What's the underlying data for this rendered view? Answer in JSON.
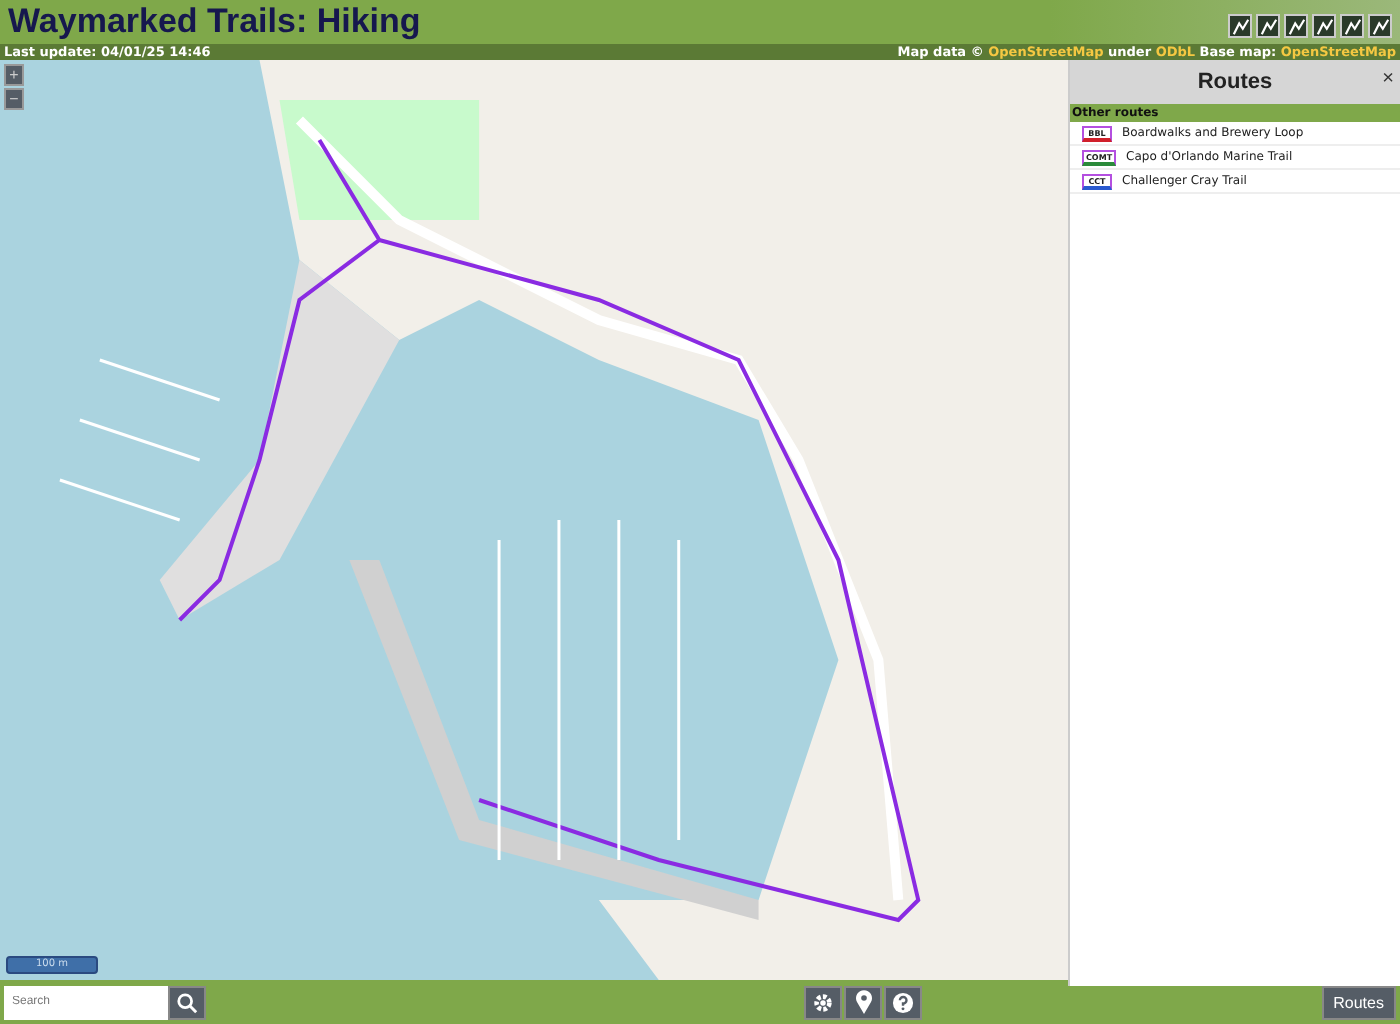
{
  "header": {
    "title": "Waymarked Trails: Hiking"
  },
  "info_bar": {
    "last_update": "Last update: 04/01/25 14:46",
    "credits": [
      {
        "kind": "text",
        "text": "Map data © "
      },
      {
        "kind": "link",
        "text": "OpenStreetMap"
      },
      {
        "kind": "text",
        "text": " under "
      },
      {
        "kind": "link",
        "text": "ODbL"
      },
      {
        "kind": "text",
        "text": " Base map: "
      },
      {
        "kind": "link",
        "text": "OpenStreetMap"
      }
    ]
  },
  "map": {
    "zoom_in": "+",
    "zoom_out": "−",
    "scale": "100 m"
  },
  "sidebar": {
    "title": "Routes",
    "close": "×",
    "section": "Other routes",
    "routes": [
      {
        "badge": "BBL",
        "color": "#d0202a",
        "name": "Boardwalks and Brewery Loop"
      },
      {
        "badge": "COMT",
        "color": "#2a8a3a",
        "name": "Capo d'Orlando Marine Trail"
      },
      {
        "badge": "CCT",
        "color": "#2a5ad0",
        "name": "Challenger Cray Trail"
      }
    ]
  },
  "bottom_bar": {
    "search": {
      "placeholder": "Search"
    },
    "routes_button": "Routes"
  }
}
